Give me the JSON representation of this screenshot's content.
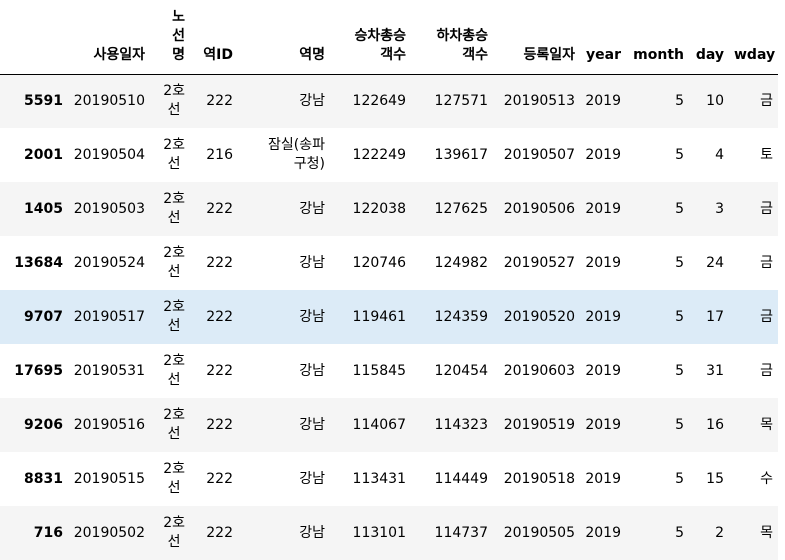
{
  "table": {
    "columns": [
      "",
      "사용일자",
      "노\n선\n명",
      "역ID",
      "역명",
      "승차총승\n객수",
      "하차총승\n객수",
      "등록일자",
      "year",
      "month",
      "day",
      "wday"
    ],
    "hovered_row": 4,
    "rows": [
      {
        "index": "5591",
        "cells": [
          "20190510",
          "2호\n선",
          "222",
          "강남",
          "122649",
          "127571",
          "20190513",
          "2019",
          "5",
          "10",
          "금"
        ]
      },
      {
        "index": "2001",
        "cells": [
          "20190504",
          "2호\n선",
          "216",
          "잠실(송파\n구청)",
          "122249",
          "139617",
          "20190507",
          "2019",
          "5",
          "4",
          "토"
        ]
      },
      {
        "index": "1405",
        "cells": [
          "20190503",
          "2호\n선",
          "222",
          "강남",
          "122038",
          "127625",
          "20190506",
          "2019",
          "5",
          "3",
          "금"
        ]
      },
      {
        "index": "13684",
        "cells": [
          "20190524",
          "2호\n선",
          "222",
          "강남",
          "120746",
          "124982",
          "20190527",
          "2019",
          "5",
          "24",
          "금"
        ]
      },
      {
        "index": "9707",
        "cells": [
          "20190517",
          "2호\n선",
          "222",
          "강남",
          "119461",
          "124359",
          "20190520",
          "2019",
          "5",
          "17",
          "금"
        ]
      },
      {
        "index": "17695",
        "cells": [
          "20190531",
          "2호\n선",
          "222",
          "강남",
          "115845",
          "120454",
          "20190603",
          "2019",
          "5",
          "31",
          "금"
        ]
      },
      {
        "index": "9206",
        "cells": [
          "20190516",
          "2호\n선",
          "222",
          "강남",
          "114067",
          "114323",
          "20190519",
          "2019",
          "5",
          "16",
          "목"
        ]
      },
      {
        "index": "8831",
        "cells": [
          "20190515",
          "2호\n선",
          "222",
          "강남",
          "113431",
          "114449",
          "20190518",
          "2019",
          "5",
          "15",
          "수"
        ]
      },
      {
        "index": "716",
        "cells": [
          "20190502",
          "2호\n선",
          "222",
          "강남",
          "113101",
          "114737",
          "20190505",
          "2019",
          "5",
          "2",
          "목"
        ]
      }
    ]
  }
}
